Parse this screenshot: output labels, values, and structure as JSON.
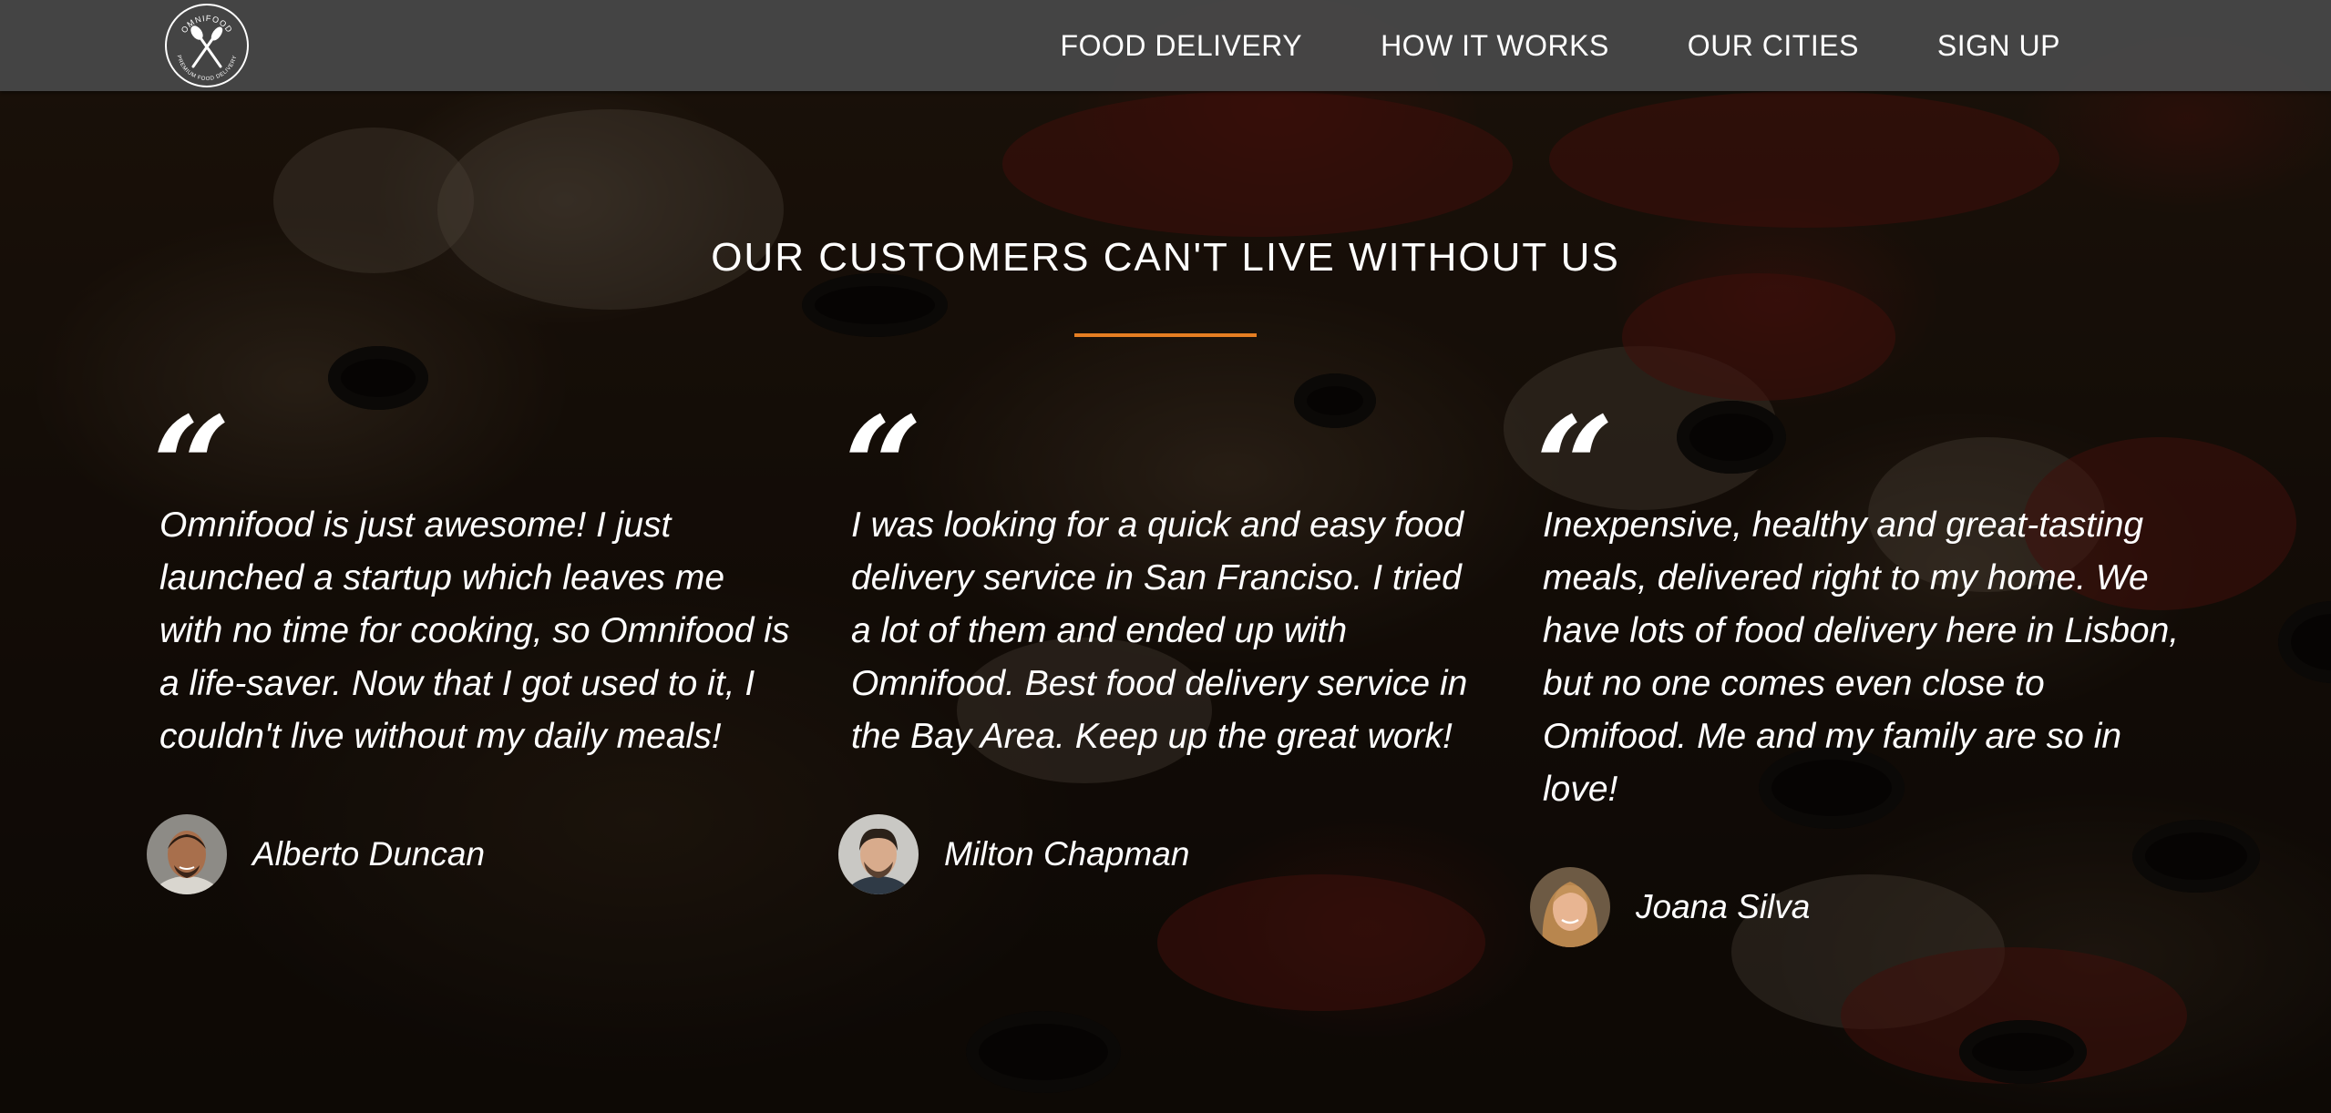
{
  "header": {
    "logo_icon": "fork-and-knife-icon",
    "logo_text_top": "OMNIFOOD",
    "logo_text_bottom": "PREMIUM FOOD DELIVERY",
    "nav": [
      {
        "label": "FOOD DELIVERY"
      },
      {
        "label": "HOW IT WORKS"
      },
      {
        "label": "OUR CITIES"
      },
      {
        "label": "SIGN UP"
      }
    ]
  },
  "section": {
    "title": "OUR CUSTOMERS CAN'T LIVE WITHOUT US",
    "accent_color": "#e67e22",
    "quote_glyph": "“",
    "testimonials": [
      {
        "text": "Omnifood is just awesome! I just launched a startup which leaves me with no time for cooking, so Omnifood is a life-saver. Now that I got used to it, I couldn't live without my daily meals!",
        "author": "Alberto Duncan"
      },
      {
        "text": "I was looking for a quick and easy food delivery service in San Franciso. I tried a lot of them and ended up with Omnifood. Best food delivery service in the Bay Area. Keep up the great work!",
        "author": "Milton Chapman"
      },
      {
        "text": "Inexpensive, healthy and great-tasting meals, delivered right to my home. We have lots of food delivery here in Lisbon, but no one comes even close to Omifood. Me and my family are so in love!",
        "author": "Joana Silva"
      }
    ]
  }
}
